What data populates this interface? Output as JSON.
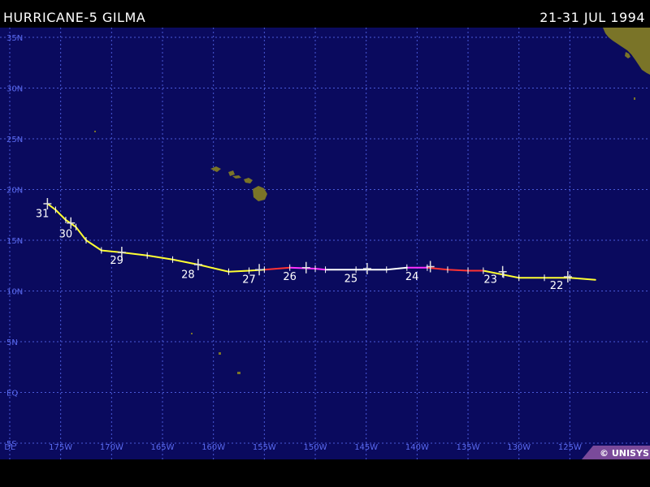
{
  "header": {
    "title": "HURRICANE-5 GILMA",
    "dates": "21-31 JUL 1994"
  },
  "credit": "© UNISYS",
  "map": {
    "region": "Central and eastern North Pacific",
    "lon_range": [
      -180,
      -120
    ],
    "lat_range": [
      -5,
      37
    ],
    "grid_lines": "dotted",
    "colors": {
      "ocean": "#0a0a5e",
      "grid": "#4a5ad8",
      "land": "#7a7428",
      "axis_label": "#5a6af0"
    },
    "lat_labels": [
      "35N",
      "30N",
      "25N",
      "20N",
      "15N",
      "10N",
      "5N",
      "EQ",
      "5S"
    ],
    "lon_labels": [
      "DL",
      "175W",
      "170W",
      "165W",
      "160W",
      "155W",
      "150W",
      "145W",
      "140W",
      "135W",
      "130W",
      "125W"
    ],
    "legend_colors": {
      "tropical_storm": "#ffff33",
      "category_3": "#ff33ff",
      "category_4": "#ff3333",
      "category_5": "#ffffff"
    }
  },
  "track_points": [
    {
      "lon": -122.5,
      "lat": 11.1,
      "cat": "tropical_storm"
    },
    {
      "lon": -125.0,
      "lat": 11.3,
      "cat": "tropical_storm"
    },
    {
      "lon": -127.5,
      "lat": 11.3,
      "cat": "tropical_storm"
    },
    {
      "lon": -130.0,
      "lat": 11.3,
      "cat": "tropical_storm"
    },
    {
      "lon": -131.5,
      "lat": 11.6,
      "cat": "tropical_storm"
    },
    {
      "lon": -133.5,
      "lat": 12.0,
      "cat": "tropical_storm"
    },
    {
      "lon": -135.0,
      "lat": 12.0,
      "cat": "category_4"
    },
    {
      "lon": -137.0,
      "lat": 12.1,
      "cat": "category_4"
    },
    {
      "lon": -139.0,
      "lat": 12.3,
      "cat": "category_4"
    },
    {
      "lon": -141.0,
      "lat": 12.3,
      "cat": "category_3"
    },
    {
      "lon": -143.0,
      "lat": 12.1,
      "cat": "category_5"
    },
    {
      "lon": -146.0,
      "lat": 12.1,
      "cat": "category_5"
    },
    {
      "lon": -149.0,
      "lat": 12.1,
      "cat": "category_5"
    },
    {
      "lon": -150.0,
      "lat": 12.2,
      "cat": "category_3"
    },
    {
      "lon": -152.5,
      "lat": 12.3,
      "cat": "category_3"
    },
    {
      "lon": -155.0,
      "lat": 12.1,
      "cat": "category_4"
    },
    {
      "lon": -156.5,
      "lat": 12.0,
      "cat": "tropical_storm"
    },
    {
      "lon": -158.5,
      "lat": 11.9,
      "cat": "tropical_storm"
    },
    {
      "lon": -161.5,
      "lat": 12.6,
      "cat": "tropical_storm"
    },
    {
      "lon": -164.0,
      "lat": 13.1,
      "cat": "tropical_storm"
    },
    {
      "lon": -166.5,
      "lat": 13.5,
      "cat": "tropical_storm"
    },
    {
      "lon": -169.0,
      "lat": 13.8,
      "cat": "tropical_storm"
    },
    {
      "lon": -171.0,
      "lat": 14.0,
      "cat": "tropical_storm"
    },
    {
      "lon": -172.5,
      "lat": 15.0,
      "cat": "tropical_storm"
    },
    {
      "lon": -173.5,
      "lat": 16.3,
      "cat": "tropical_storm"
    },
    {
      "lon": -174.5,
      "lat": 17.0,
      "cat": "tropical_storm"
    },
    {
      "lon": -175.5,
      "lat": 18.0,
      "cat": "tropical_storm"
    },
    {
      "lon": -176.3,
      "lat": 18.6,
      "cat": "tropical_storm"
    }
  ],
  "day_labels": [
    {
      "text": "22",
      "lon": -126.3,
      "lat": 10.2
    },
    {
      "text": "23",
      "lon": -132.8,
      "lat": 10.8
    },
    {
      "text": "24",
      "lon": -140.5,
      "lat": 11.1
    },
    {
      "text": "25",
      "lon": -146.5,
      "lat": 10.9
    },
    {
      "text": "26",
      "lon": -152.5,
      "lat": 11.1
    },
    {
      "text": "27",
      "lon": -156.5,
      "lat": 10.8
    },
    {
      "text": "28",
      "lon": -162.5,
      "lat": 11.3
    },
    {
      "text": "29",
      "lon": -169.5,
      "lat": 12.7
    },
    {
      "text": "30",
      "lon": -174.5,
      "lat": 15.3
    },
    {
      "text": "31",
      "lon": -176.8,
      "lat": 17.3
    }
  ],
  "day_markers": [
    {
      "lon": -125.2,
      "lat": 11.4
    },
    {
      "lon": -131.6,
      "lat": 11.9
    },
    {
      "lon": -138.7,
      "lat": 12.4
    },
    {
      "lon": -144.9,
      "lat": 12.2
    },
    {
      "lon": -150.9,
      "lat": 12.3
    },
    {
      "lon": -155.5,
      "lat": 12.1
    },
    {
      "lon": -161.5,
      "lat": 12.6
    },
    {
      "lon": -169.0,
      "lat": 13.8
    },
    {
      "lon": -174.0,
      "lat": 16.7
    },
    {
      "lon": -176.3,
      "lat": 18.6
    }
  ]
}
